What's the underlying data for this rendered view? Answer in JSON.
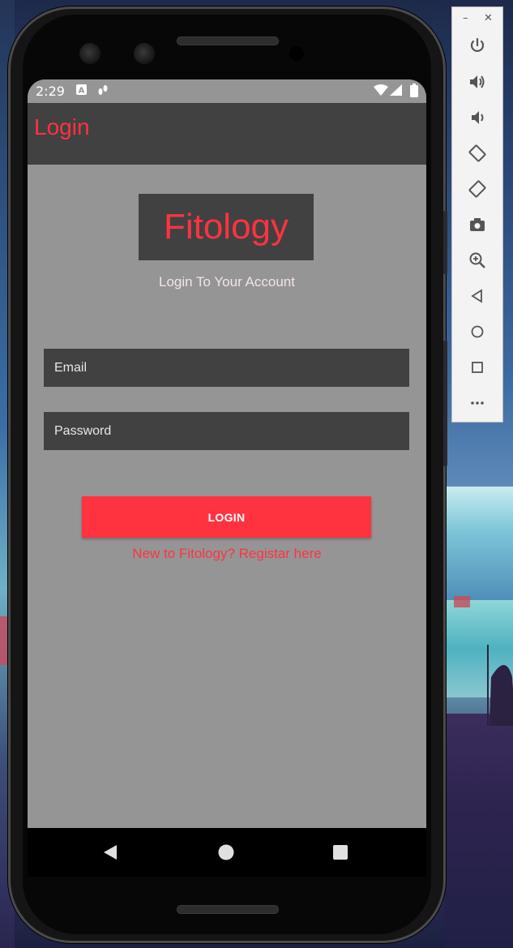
{
  "status_bar": {
    "time": "2:29",
    "icons": [
      "a-notification-icon",
      "footsteps-icon",
      "wifi-icon",
      "cell-signal-icon",
      "battery-icon"
    ]
  },
  "app_bar": {
    "title": "Login"
  },
  "logo": {
    "text": "Fitology"
  },
  "subtitle": "Login To Your Account",
  "email": {
    "placeholder": "Email",
    "value": ""
  },
  "password": {
    "placeholder": "Password",
    "value": ""
  },
  "login_button": {
    "label": "LOGIN"
  },
  "register_link": "New to Fitology? Registar here",
  "nav_bar": [
    "back-icon",
    "home-icon",
    "recents-icon"
  ],
  "emulator_panel": {
    "window_controls": [
      "minimize-icon",
      "close-icon"
    ],
    "tools": [
      "power-icon",
      "volume-up-icon",
      "volume-down-icon",
      "rotate-left-icon",
      "rotate-right-icon",
      "camera-icon",
      "zoom-icon",
      "back-icon",
      "home-icon",
      "overview-icon",
      "more-icon"
    ]
  },
  "colors": {
    "accent": "#ff3340",
    "screen_bg": "#959595",
    "surface": "#414141",
    "subtitle_text": "#f2e4e8"
  }
}
